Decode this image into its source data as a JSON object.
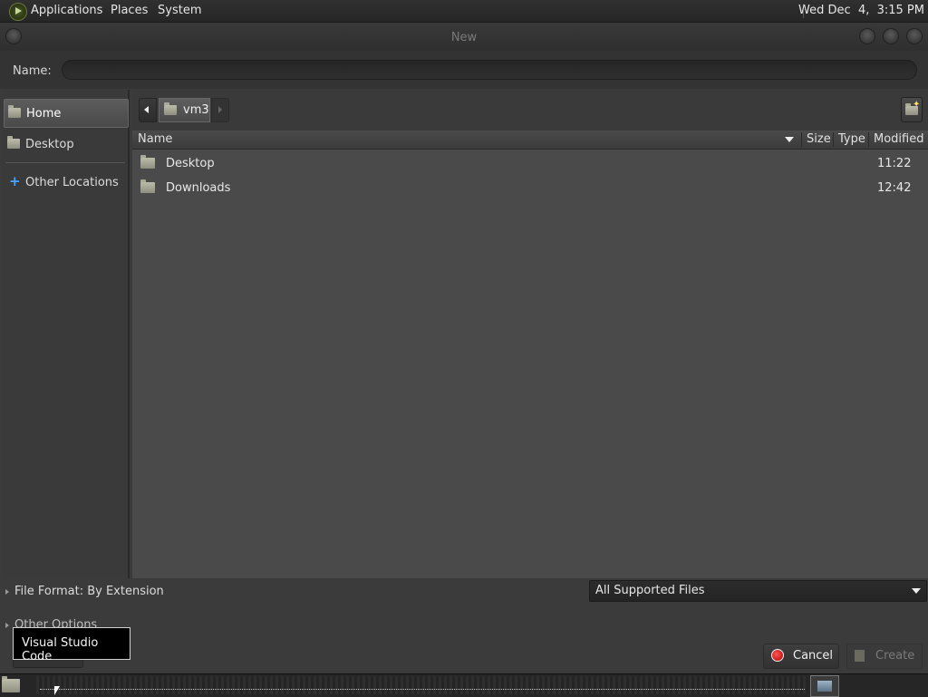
{
  "top_panel": {
    "menus": [
      "Applications",
      "Places",
      "System"
    ],
    "clock": "Wed Dec  4,  3:15 PM"
  },
  "dialog": {
    "title": "New",
    "name_label": "Name:",
    "name_value": ""
  },
  "sidebar": {
    "items": [
      {
        "label": "Home",
        "icon": "home-folder-icon",
        "selected": true
      },
      {
        "label": "Desktop",
        "icon": "desktop-folder-icon",
        "selected": false
      },
      {
        "label": "Other Locations",
        "icon": "plus-icon",
        "selected": false
      }
    ]
  },
  "pathbar": {
    "crumb": "vm3"
  },
  "file_list": {
    "columns": [
      "Name",
      "Size",
      "Type",
      "Modified"
    ],
    "rows": [
      {
        "name": "Desktop",
        "size": "",
        "type": "",
        "modified": "11:22",
        "icon": "desktop-folder-icon"
      },
      {
        "name": "Downloads",
        "size": "",
        "type": "",
        "modified": "12:42",
        "icon": "folder-icon"
      }
    ]
  },
  "bottom": {
    "file_format": "File Format: By Extension",
    "filter": "All Supported Files",
    "other_options": "Other Options",
    "tooltip": "Visual Studio Code",
    "cancel_label": "Cancel",
    "create_label": "Create"
  },
  "colors": {
    "background": "#3b3b3b",
    "list_background": "#4a4a4a",
    "cancel_icon": "#d00000",
    "tooltip_background": "#000000"
  }
}
